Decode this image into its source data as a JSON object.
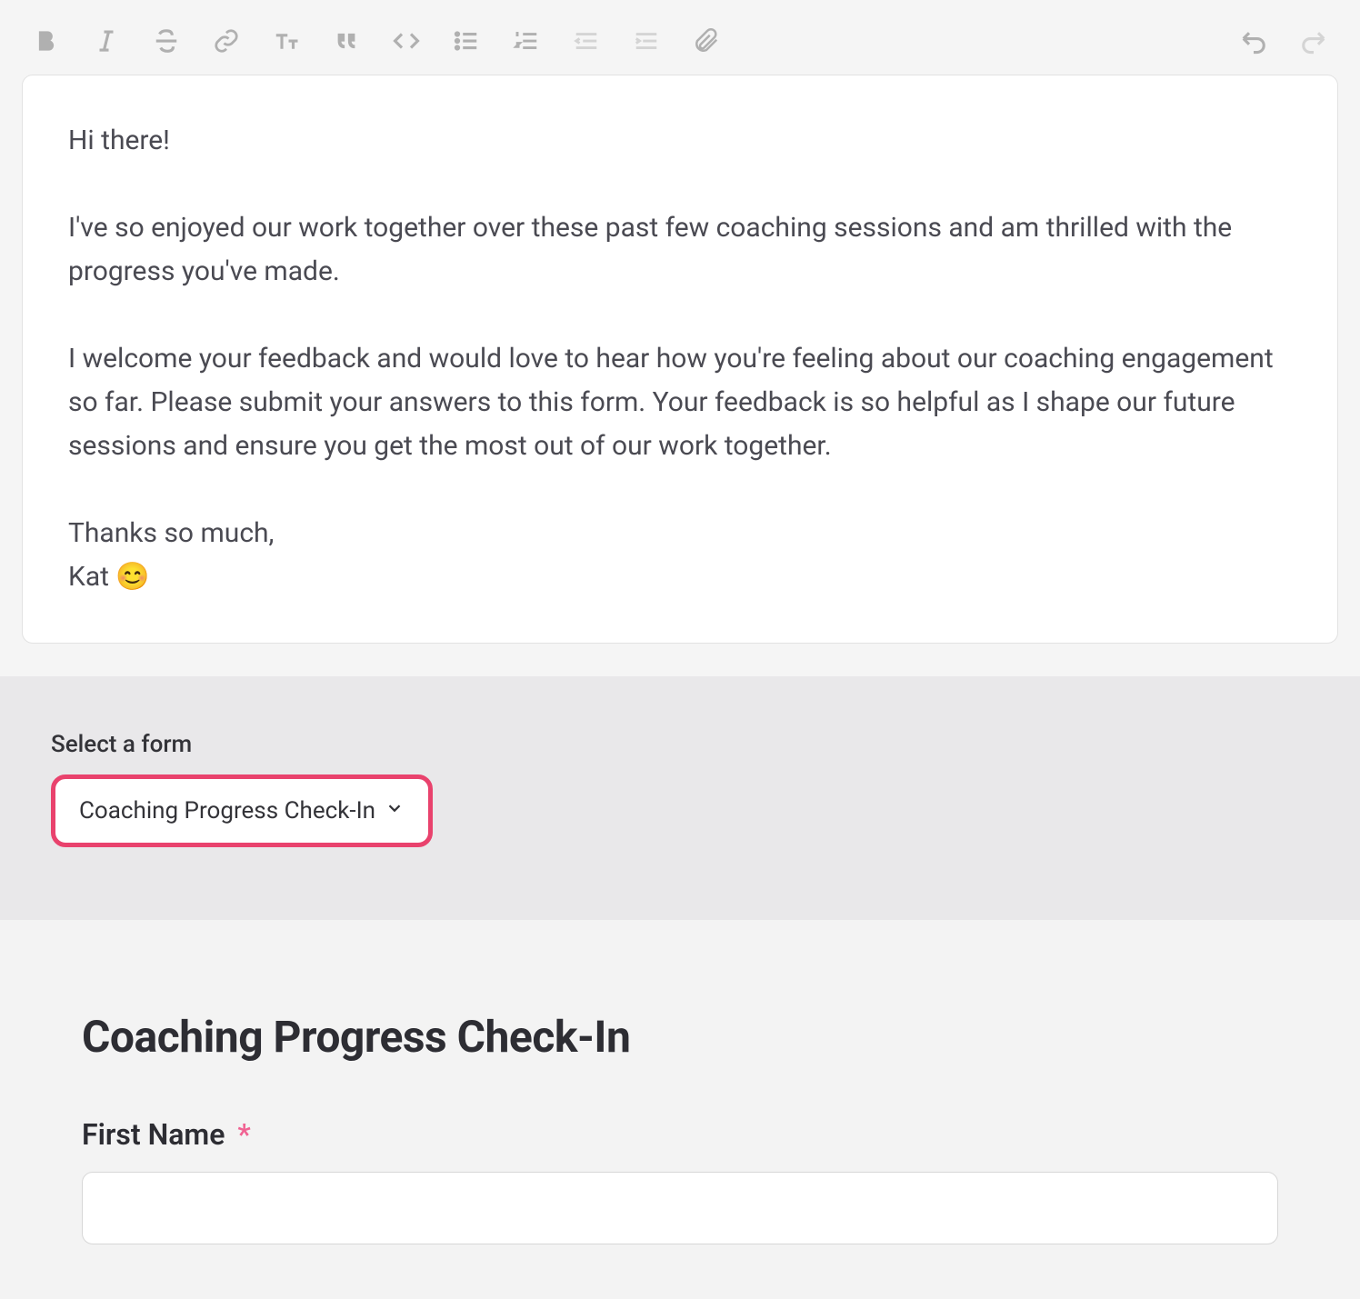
{
  "toolbar": {
    "bold": "Bold",
    "italic": "Italic",
    "strike": "Strikethrough",
    "link": "Link",
    "textsize": "Text size",
    "quote": "Blockquote",
    "code": "Code",
    "bullet": "Bulleted list",
    "numbered": "Numbered list",
    "outdent": "Outdent",
    "indent": "Indent",
    "attach": "Attachment",
    "undo": "Undo",
    "redo": "Redo"
  },
  "editor": {
    "line1": "Hi there!",
    "line2": "I've so enjoyed our work together over these past few coaching sessions and am thrilled with the progress you've made.",
    "line3": "I welcome your feedback and would love to hear how you're feeling about our coaching engagement so far. Please submit your answers to this form. Your feedback is so helpful as I shape our future sessions and ensure you get the most out of our work together.",
    "line4": "Thanks so much,",
    "line5": "Kat 😊"
  },
  "selector": {
    "label": "Select a form",
    "selected": "Coaching Progress Check-In"
  },
  "preview": {
    "title": "Coaching Progress Check-In",
    "field1_label": "First Name",
    "required_mark": "*",
    "field1_value": ""
  }
}
